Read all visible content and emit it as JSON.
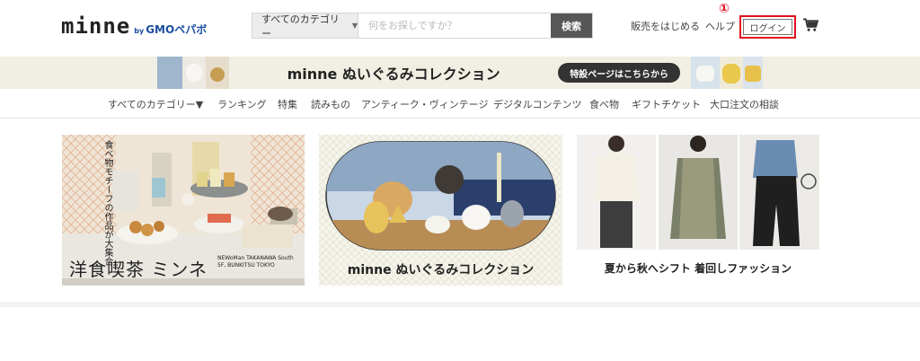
{
  "header": {
    "logo_text": "minne",
    "logo_by": "by",
    "logo_gmo": "GMOペパボ",
    "search_category": "すべてのカテゴリー",
    "search_placeholder": "何をお探しですか？",
    "search_button": "検索",
    "sell_link": "販売をはじめる",
    "help_link": "ヘルプ",
    "login_button": "ログイン",
    "annotation_marker": "①",
    "cart_icon": "cart-icon"
  },
  "promo": {
    "title": "minne ぬいぐるみコレクション",
    "cta": "特設ページはこちらから"
  },
  "nav": {
    "items": [
      "すべてのカテゴリー▼",
      "ランキング",
      "特集",
      "読みもの",
      "アンティーク・ヴィンテージ",
      "デジタルコンテンツ",
      "食べ物",
      "ギフトチケット",
      "大口注文の相談"
    ]
  },
  "banners": [
    {
      "side_text": "食べ物モチーフの作品が大集合",
      "title": "洋食喫茶 ミンネ",
      "subtitle": "NEWoMan TAKANAWA South 5F, BUNKITSU TOKYO"
    },
    {
      "title": "minne ぬいぐるみコレクション"
    },
    {
      "title": "夏から秋へシフト 着回しファッション"
    }
  ],
  "colors": {
    "accent_red": "#e01020",
    "promo_bg": "#f1efe3",
    "search_btn": "#575757"
  }
}
